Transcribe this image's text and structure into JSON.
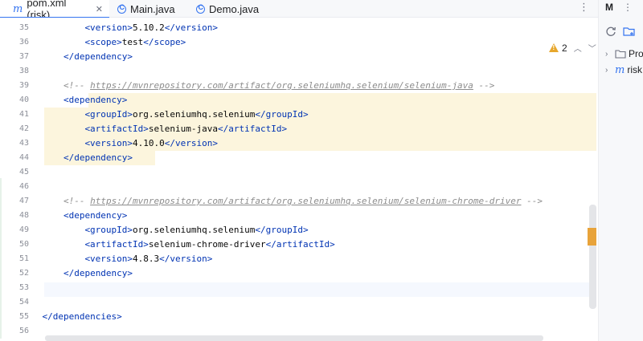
{
  "tabs": [
    {
      "label": "pom.xml (risk)",
      "icon": "maven-m-icon",
      "active": true
    },
    {
      "label": "Main.java",
      "icon": "java-class-icon",
      "active": false
    },
    {
      "label": "Demo.java",
      "icon": "java-class-icon",
      "active": false
    }
  ],
  "tab_icons": {
    "m": "m"
  },
  "inspection": {
    "warning_count": "2"
  },
  "side_panel": {
    "title_glyph": "M",
    "tree": [
      {
        "label": "Pro",
        "icon": "folder-icon"
      },
      {
        "label": "risk",
        "icon": "maven-m-icon",
        "glyph": "m"
      }
    ]
  },
  "editor": {
    "line_numbers": [
      "35",
      "36",
      "37",
      "38",
      "39",
      "40",
      "41",
      "42",
      "43",
      "44",
      "45",
      "46",
      "47",
      "48",
      "49",
      "50",
      "51",
      "52",
      "53",
      "54",
      "55",
      "56"
    ],
    "lines": [
      {
        "indent": "            ",
        "open": "<version>",
        "text": "5.10.2",
        "close": "</version>"
      },
      {
        "indent": "            ",
        "open": "<scope>",
        "text": "test",
        "close": "</scope>"
      },
      {
        "indent": "        ",
        "open": "</dependency>",
        "text": "",
        "close": ""
      },
      {
        "indent": "",
        "open": "",
        "text": "",
        "close": ""
      },
      {
        "indent": "        ",
        "comment_start": "<!-- ",
        "comment_link": "https://mvnrepository.com/artifact/org.seleniumhq.selenium/selenium-java",
        "comment_end": " -->"
      },
      {
        "indent": "        ",
        "open": "<dependency>",
        "text": "",
        "close": ""
      },
      {
        "indent": "            ",
        "open": "<groupId>",
        "text": "org.seleniumhq.selenium",
        "close": "</groupId>"
      },
      {
        "indent": "            ",
        "open": "<artifactId>",
        "text": "selenium-java",
        "close": "</artifactId>"
      },
      {
        "indent": "            ",
        "open": "<version>",
        "text": "4.10.0",
        "close": "</version>"
      },
      {
        "indent": "        ",
        "open": "</dependency>",
        "text": "",
        "close": ""
      },
      {
        "indent": "",
        "open": "",
        "text": "",
        "close": ""
      },
      {
        "indent": "",
        "open": "",
        "text": "",
        "close": ""
      },
      {
        "indent": "        ",
        "comment_start": "<!-- ",
        "comment_link": "https://mvnrepository.com/artifact/org.seleniumhq.selenium/selenium-chrome-driver",
        "comment_end": " -->"
      },
      {
        "indent": "        ",
        "open": "<dependency>",
        "text": "",
        "close": ""
      },
      {
        "indent": "            ",
        "open": "<groupId>",
        "text": "org.seleniumhq.selenium",
        "close": "</groupId>"
      },
      {
        "indent": "            ",
        "open": "<artifactId>",
        "text": "selenium-chrome-driver",
        "close": "</artifactId>"
      },
      {
        "indent": "            ",
        "open": "<version>",
        "text": "4.8.3",
        "close": "</version>"
      },
      {
        "indent": "        ",
        "open": "</dependency>",
        "text": "",
        "close": ""
      },
      {
        "indent": "",
        "open": "",
        "text": "",
        "close": ""
      },
      {
        "indent": "",
        "open": "",
        "text": "",
        "close": ""
      },
      {
        "indent": "    ",
        "open": "</dependencies>",
        "text": "",
        "close": ""
      },
      {
        "indent": "",
        "open": "",
        "text": "",
        "close": ""
      }
    ]
  },
  "colors": {
    "accent": "#3574f0",
    "tag": "#0033b3",
    "comment": "#8c8c8c",
    "highlight": "#fcf5dd",
    "warning": "#e7a72c"
  }
}
